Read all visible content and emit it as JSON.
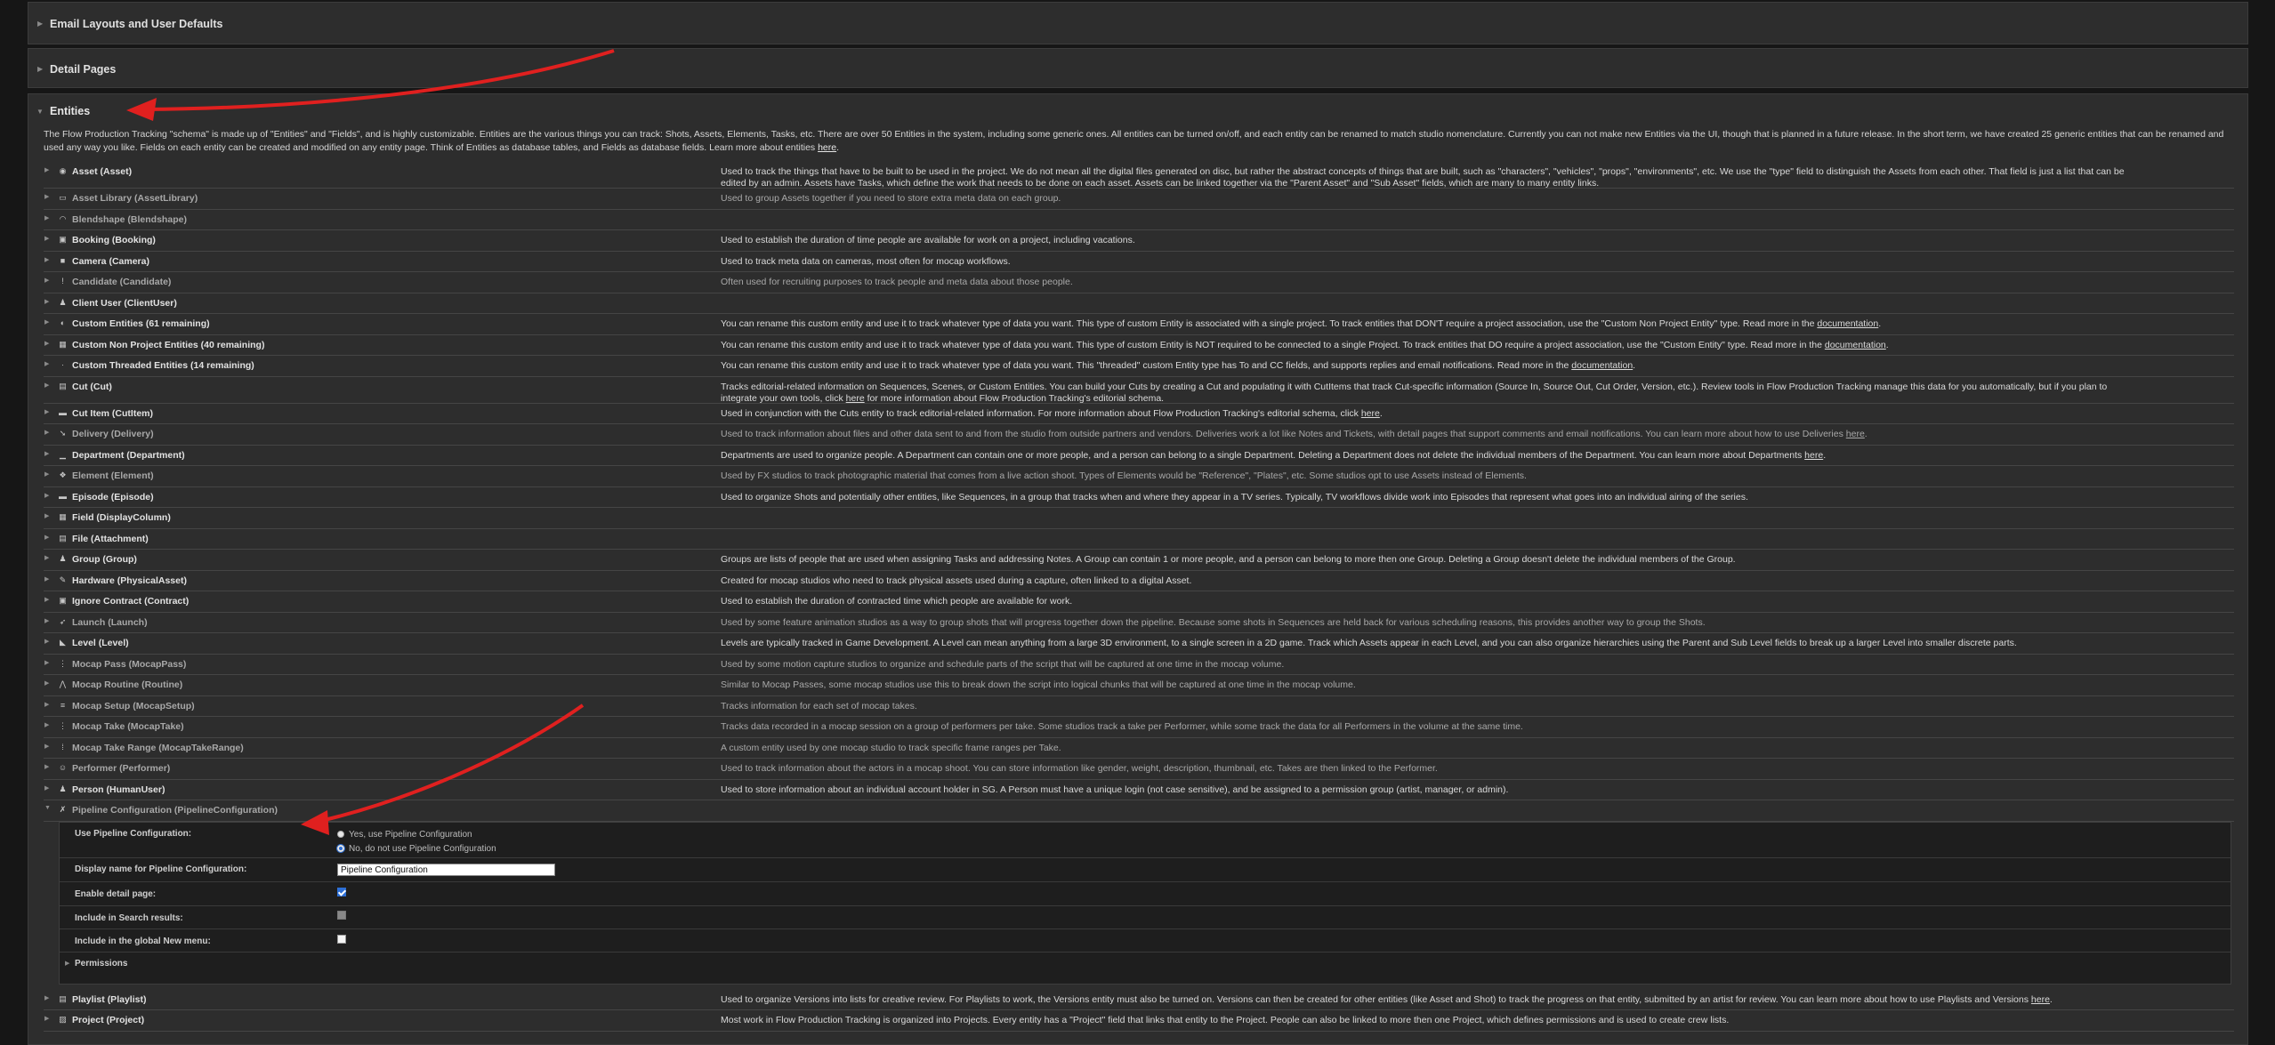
{
  "sections": {
    "email": "Email Layouts and User Defaults",
    "detail": "Detail Pages",
    "entities": "Entities"
  },
  "intro": {
    "text": "The Flow Production Tracking \"schema\" is made up of \"Entities\" and \"Fields\", and is highly customizable. Entities are the various things you can track: Shots, Assets, Elements, Tasks, etc. There are over 50 Entities in the system, including some generic ones. All entities can be turned on/off, and each entity can be renamed to match studio nomenclature. Currently you can not make new Entities via the UI, though that is planned in a future release. In the short term, we have created 25 generic entities that can be renamed and used any way you like. Fields on each entity can be created and modified on any entity page. Think of Entities as database tables, and Fields as database fields. Learn more about entities ",
    "link": "here"
  },
  "entities": [
    {
      "name": "Asset (Asset)",
      "icon": "asset-icon",
      "glyph": "◉",
      "dim": false,
      "tall": true,
      "desc": "Used to track the things that have to be built to be used in the project. We do not mean all the digital files generated on disc, but rather the abstract concepts of things that are built, such as \"characters\", \"vehicles\", \"props\", \"environments\", etc. We use the \"type\" field to distinguish the Assets from each other. That field is just a list that can be edited by an admin. Assets have Tasks, which define the work that needs to be done on each asset. Assets can be linked together via the \"Parent Asset\" and \"Sub Asset\" fields, which are many to many entity links.",
      "link": ""
    },
    {
      "name": "Asset Library (AssetLibrary)",
      "icon": "asset-library-icon",
      "glyph": "▭",
      "dim": true,
      "desc": "Used to group Assets together if you need to store extra meta data on each group.",
      "link": ""
    },
    {
      "name": "Blendshape (Blendshape)",
      "icon": "blendshape-icon",
      "glyph": "◠",
      "dim": true,
      "desc": "",
      "link": ""
    },
    {
      "name": "Booking (Booking)",
      "icon": "booking-icon",
      "glyph": "▣",
      "dim": false,
      "desc": "Used to establish the duration of time people are available for work on a project, including vacations.",
      "link": ""
    },
    {
      "name": "Camera (Camera)",
      "icon": "camera-icon",
      "glyph": "■",
      "dim": false,
      "desc": "Used to track meta data on cameras, most often for mocap workflows.",
      "link": ""
    },
    {
      "name": "Candidate (Candidate)",
      "icon": "candidate-icon",
      "glyph": "!",
      "dim": true,
      "desc": "Often used for recruiting purposes to track people and meta data about those people.",
      "link": ""
    },
    {
      "name": "Client User (ClientUser)",
      "icon": "client-user-icon",
      "glyph": "♟",
      "dim": false,
      "desc": "",
      "link": ""
    },
    {
      "name": "Custom Entities (61 remaining)",
      "icon": "custom-entities-icon",
      "glyph": "◐",
      "dim": false,
      "desc": "You can rename this custom entity and use it to track whatever type of data you want. This type of custom Entity is associated with a single project. To track entities that DON'T require a project association, use the \"Custom Non Project Entity\" type. Read more in the ",
      "link": "documentation",
      "after": "."
    },
    {
      "name": "Custom Non Project Entities (40 remaining)",
      "icon": "custom-non-project-icon",
      "glyph": "▦",
      "dim": false,
      "desc": "You can rename this custom entity and use it to track whatever type of data you want. This type of custom Entity is NOT required to be connected to a single Project. To track entities that DO require a project association, use the \"Custom Entity\" type. Read more in the ",
      "link": "documentation",
      "after": "."
    },
    {
      "name": "Custom Threaded Entities (14 remaining)",
      "icon": "custom-threaded-icon",
      "glyph": "·",
      "dim": false,
      "desc": "You can rename this custom entity and use it to track whatever type of data you want. This \"threaded\" custom Entity type has To and CC fields, and supports replies and email notifications. Read more in the ",
      "link": "documentation",
      "after": "."
    },
    {
      "name": "Cut (Cut)",
      "icon": "cut-icon",
      "glyph": "▤",
      "dim": false,
      "tall": true,
      "desc": "Tracks editorial-related information on Sequences, Scenes, or Custom Entities. You can build your Cuts by creating a Cut and populating it with CutItems that track Cut-specific information (Source In, Source Out, Cut Order, Version, etc.). Review tools in Flow Production Tracking manage this data for you automatically, but if you plan to integrate your own tools, click ",
      "link": "here",
      "after": " for more information about Flow Production Tracking's editorial schema."
    },
    {
      "name": "Cut Item (CutItem)",
      "icon": "cut-item-icon",
      "glyph": "▬",
      "dim": false,
      "desc": "Used in conjunction with the Cuts entity to track editorial-related information. For more information about Flow Production Tracking's editorial schema, click ",
      "link": "here",
      "after": "."
    },
    {
      "name": "Delivery (Delivery)",
      "icon": "delivery-icon",
      "glyph": "➘",
      "dim": true,
      "desc": "Used to track information about files and other data sent to and from the studio from outside partners and vendors. Deliveries work a lot like Notes and Tickets, with detail pages that support comments and email notifications. You can learn more about how to use Deliveries ",
      "link": "here",
      "after": "."
    },
    {
      "name": "Department (Department)",
      "icon": "department-icon",
      "glyph": "▁",
      "dim": false,
      "desc": "Departments are used to organize people. A Department can contain one or more people, and a person can belong to a single Department. Deleting a Department does not delete the individual members of the Department. You can learn more about Departments ",
      "link": "here",
      "after": "."
    },
    {
      "name": "Element (Element)",
      "icon": "element-icon",
      "glyph": "❖",
      "dim": true,
      "desc": "Used by FX studios to track photographic material that comes from a live action shoot. Types of Elements would be \"Reference\", \"Plates\", etc. Some studios opt to use Assets instead of Elements.",
      "link": ""
    },
    {
      "name": "Episode (Episode)",
      "icon": "episode-icon",
      "glyph": "▬",
      "dim": false,
      "desc": "Used to organize Shots and potentially other entities, like Sequences, in a group that tracks when and where they appear in a TV series. Typically, TV workflows divide work into Episodes that represent what goes into an individual airing of the series.",
      "link": ""
    },
    {
      "name": "Field (DisplayColumn)",
      "icon": "field-icon",
      "glyph": "▦",
      "dim": false,
      "desc": "",
      "link": ""
    },
    {
      "name": "File (Attachment)",
      "icon": "file-icon",
      "glyph": "▤",
      "dim": false,
      "desc": "",
      "link": ""
    },
    {
      "name": "Group (Group)",
      "icon": "group-icon",
      "glyph": "♟",
      "dim": false,
      "desc": "Groups are lists of people that are used when assigning Tasks and addressing Notes. A Group can contain 1 or more people, and a person can belong to more then one Group. Deleting a Group doesn't delete the individual members of the Group.",
      "link": ""
    },
    {
      "name": "Hardware (PhysicalAsset)",
      "icon": "hardware-icon",
      "glyph": "✎",
      "dim": false,
      "desc": "Created for mocap studios who need to track physical assets used during a capture, often linked to a digital Asset.",
      "link": ""
    },
    {
      "name": "Ignore Contract (Contract)",
      "icon": "contract-icon",
      "glyph": "▣",
      "dim": false,
      "desc": "Used to establish the duration of contracted time which people are available for work.",
      "link": ""
    },
    {
      "name": "Launch (Launch)",
      "icon": "launch-icon",
      "glyph": "➶",
      "dim": true,
      "desc": "Used by some feature animation studios as a way to group shots that will progress together down the pipeline. Because some shots in Sequences are held back for various scheduling reasons, this provides another way to group the Shots.",
      "link": ""
    },
    {
      "name": "Level (Level)",
      "icon": "level-icon",
      "glyph": "◣",
      "dim": false,
      "desc": "Levels are typically tracked in Game Development. A Level can mean anything from a large 3D environment, to a single screen in a 2D game. Track which Assets appear in each Level, and you can also organize hierarchies using the Parent and Sub Level fields to break up a larger Level into smaller discrete parts.",
      "link": ""
    },
    {
      "name": "Mocap Pass (MocapPass)",
      "icon": "mocap-pass-icon",
      "glyph": "⋮",
      "dim": true,
      "desc": "Used by some motion capture studios to organize and schedule parts of the script that will be captured at one time in the mocap volume.",
      "link": ""
    },
    {
      "name": "Mocap Routine (Routine)",
      "icon": "mocap-routine-icon",
      "glyph": "⋀",
      "dim": true,
      "desc": "Similar to Mocap Passes, some mocap studios use this to break down the script into logical chunks that will be captured at one time in the mocap volume.",
      "link": ""
    },
    {
      "name": "Mocap Setup (MocapSetup)",
      "icon": "mocap-setup-icon",
      "glyph": "≡",
      "dim": true,
      "desc": "Tracks information for each set of mocap takes.",
      "link": ""
    },
    {
      "name": "Mocap Take (MocapTake)",
      "icon": "mocap-take-icon",
      "glyph": "⋮",
      "dim": true,
      "desc": "Tracks data recorded in a mocap session on a group of performers per take. Some studios track a take per Performer, while some track the data for all Performers in the volume at the same time.",
      "link": ""
    },
    {
      "name": "Mocap Take Range (MocapTakeRange)",
      "icon": "mocap-take-range-icon",
      "glyph": "⁞",
      "dim": true,
      "desc": "A custom entity used by one mocap studio to track specific frame ranges per Take.",
      "link": ""
    },
    {
      "name": "Performer (Performer)",
      "icon": "performer-icon",
      "glyph": "☺",
      "dim": true,
      "desc": "Used to track information about the actors in a mocap shoot. You can store information like gender, weight, description, thumbnail, etc. Takes are then linked to the Performer.",
      "link": ""
    },
    {
      "name": "Person (HumanUser)",
      "icon": "person-icon",
      "glyph": "♟",
      "dim": false,
      "desc": "Used to store information about an individual account holder in SG. A Person must have a unique login (not case sensitive), and be assigned to a permission group (artist, manager, or admin).",
      "link": ""
    },
    {
      "name": "Pipeline Configuration (PipelineConfiguration)",
      "icon": "pipeline-configuration-icon",
      "glyph": "✗",
      "dim": true,
      "expanded": true,
      "desc": "",
      "link": ""
    }
  ],
  "config": {
    "use_label": "Use Pipeline Configuration:",
    "opt_yes": "Yes, use Pipeline Configuration",
    "opt_no": "No, do not use Pipeline Configuration",
    "display_label": "Display name for Pipeline Configuration:",
    "display_value": "Pipeline Configuration",
    "detail_label": "Enable detail page:",
    "search_label": "Include in Search results:",
    "new_menu_label": "Include in the global New menu:",
    "permissions": "Permissions"
  },
  "entities_after": [
    {
      "name": "Playlist (Playlist)",
      "icon": "playlist-icon",
      "glyph": "▤",
      "dim": false,
      "desc": "Used to organize Versions into lists for creative review. For Playlists to work, the Versions entity must also be turned on. Versions can then be created for other entities (like Asset and Shot) to track the progress on that entity, submitted by an artist for review. You can learn more about how to use Playlists and Versions ",
      "link": "here",
      "after": "."
    },
    {
      "name": "Project (Project)",
      "icon": "project-icon",
      "glyph": "▨",
      "dim": false,
      "desc": "Most work in Flow Production Tracking is organized into Projects. Every entity has a \"Project\" field that links that entity to the Project. People can also be linked to more then one Project, which defines permissions and is used to create crew lists.",
      "link": ""
    }
  ],
  "colors": {
    "accent": "#e0201f",
    "panel": "#2d2d2d",
    "bg": "#161616",
    "check": "#2d6fd6"
  }
}
